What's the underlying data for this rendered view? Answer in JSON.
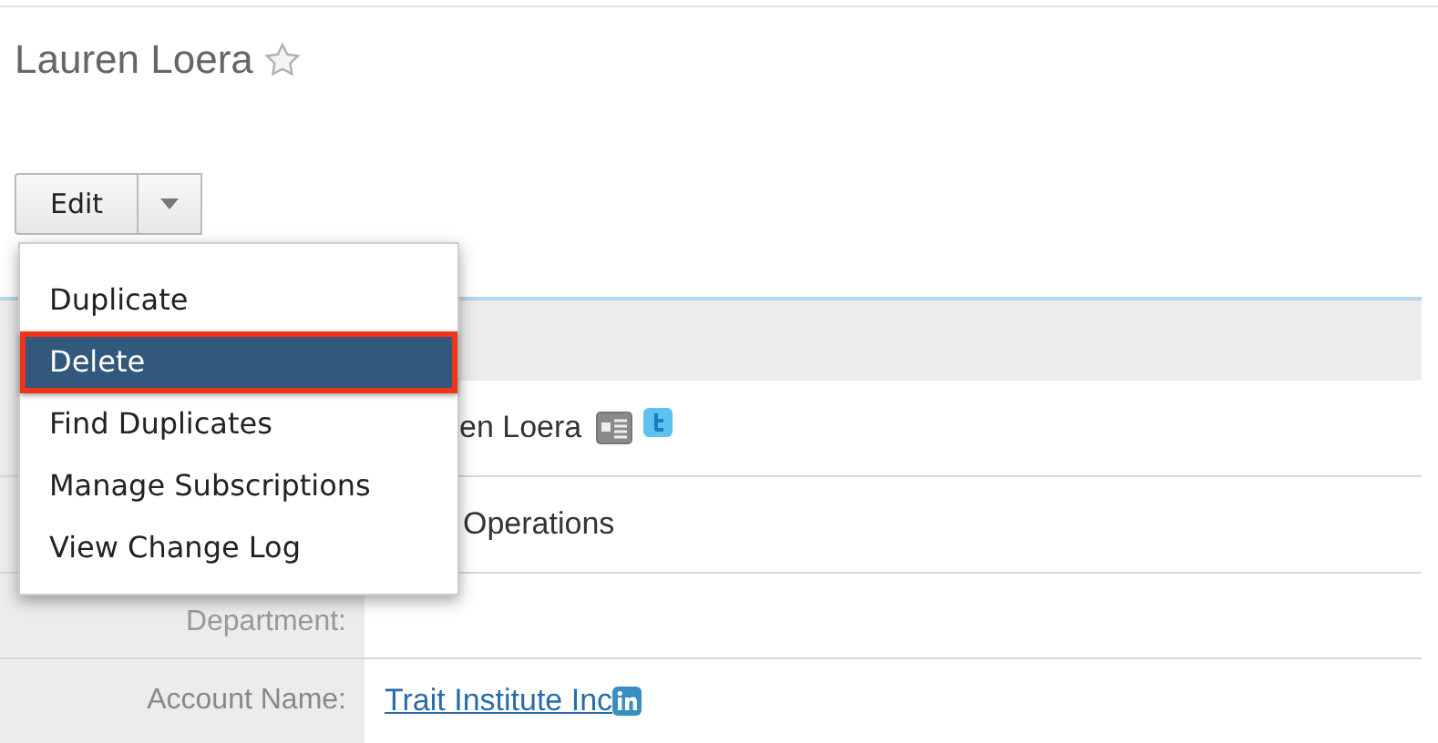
{
  "title": "Lauren Loera",
  "favorite": false,
  "edit_button": {
    "label": "Edit"
  },
  "menu": [
    {
      "label": "Duplicate",
      "selected": false
    },
    {
      "label": "Delete",
      "selected": true
    },
    {
      "label": "Find Duplicates",
      "selected": false
    },
    {
      "label": "Manage Subscriptions",
      "selected": false
    },
    {
      "label": "View Change Log",
      "selected": false
    }
  ],
  "fields": [
    {
      "kind": "name",
      "value": "en Loera"
    },
    {
      "kind": "text",
      "value": "Operations"
    },
    {
      "kind": "text",
      "label": "Department:"
    },
    {
      "kind": "link",
      "label": "Account Name:",
      "value": "Trait Institute Inc"
    }
  ]
}
